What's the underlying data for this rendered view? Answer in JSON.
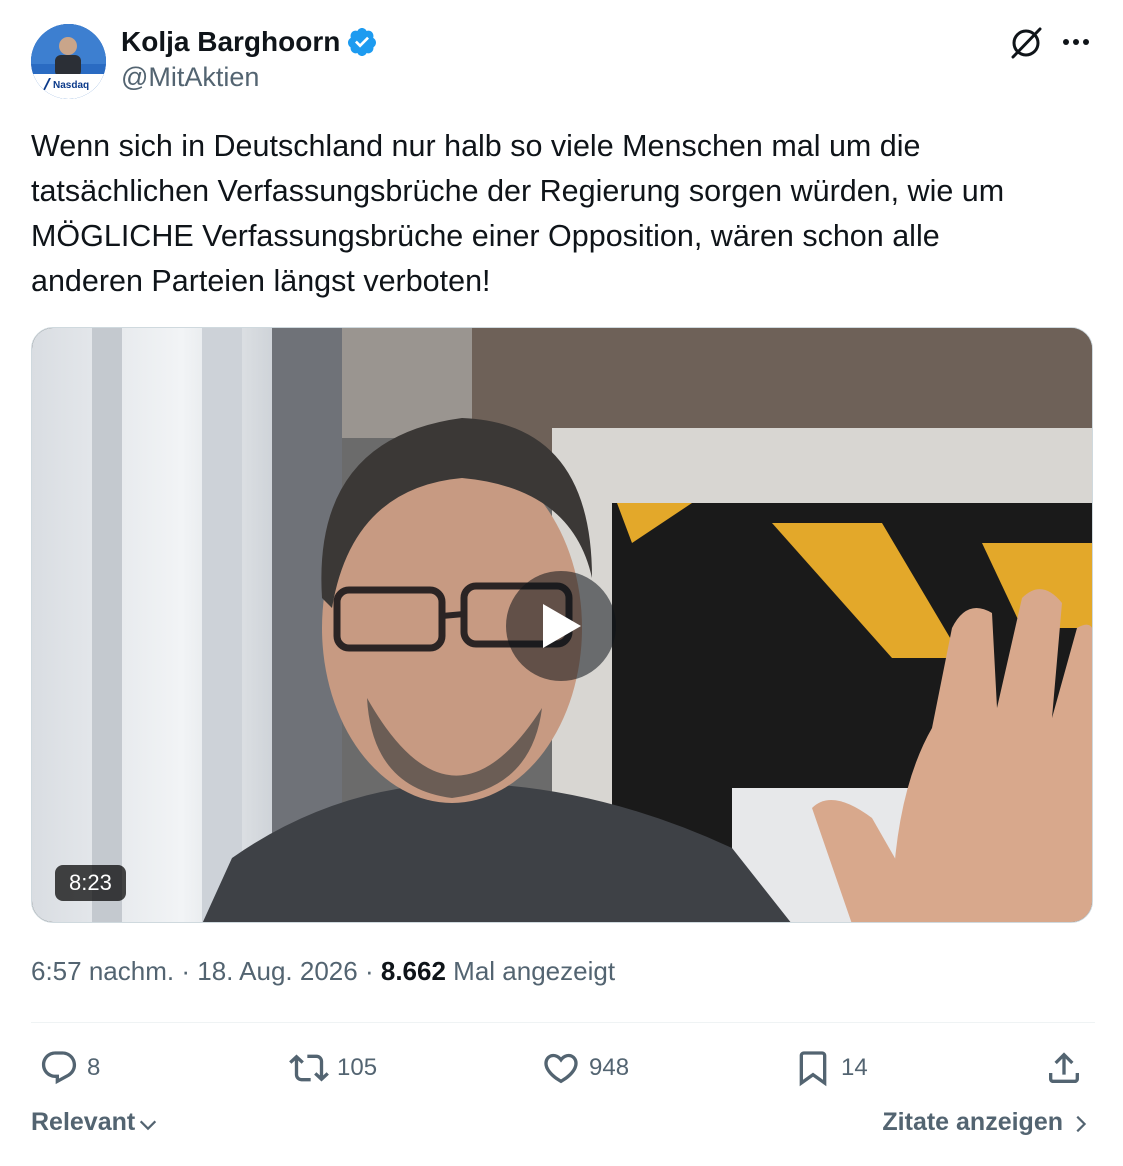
{
  "author": {
    "name": "Kolja Barghoorn",
    "handle": "@MitAktien",
    "avatar_badge_text": "Nasdaq"
  },
  "tweet": {
    "lines": [
      "Wenn sich in Deutschland nur halb so viele Menschen mal um die",
      "tatsächlichen Verfassungsbrüche der Regierung sorgen würden, wie um",
      "MÖGLICHE Verfassungsbrüche einer Opposition, wären schon alle",
      "anderen Parteien längst verboten!"
    ]
  },
  "video": {
    "duration": "8:23"
  },
  "meta": {
    "time": "6:57 nachm.",
    "separator": "·",
    "date": "18. Aug. 2026",
    "views": "8.662",
    "views_label": "Mal angezeigt"
  },
  "actions": {
    "replies": "8",
    "reposts": "105",
    "likes": "948",
    "bookmarks": "14"
  },
  "footer": {
    "sort_label": "Relevant",
    "quotes_label": "Zitate anzeigen"
  },
  "colors": {
    "verified": "#1d9bf0",
    "secondary_text": "#536471",
    "primary_text": "#0f1419"
  }
}
